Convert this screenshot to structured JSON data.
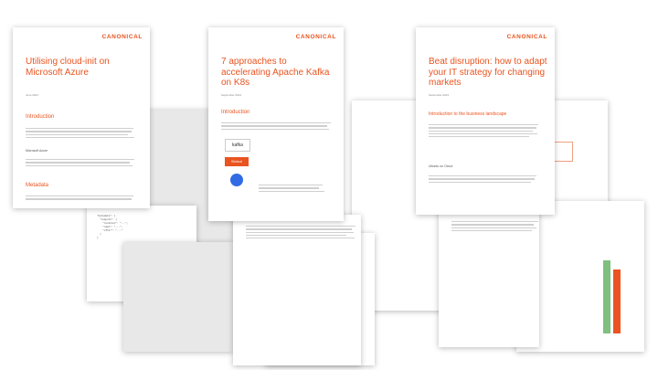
{
  "brand": {
    "logo": "CANONICAL",
    "accent": "#e95420"
  },
  "docs": [
    {
      "title": "Utilising cloud-init on Microsoft Azure",
      "date": "June 2021",
      "sections": [
        "Introduction",
        "Metadata"
      ],
      "subsection": "Microsoft Azure"
    },
    {
      "title": "7 approaches to accelerating Apache Kafka on K8s",
      "date": "September 2021",
      "section": "Introduction",
      "badges": [
        "kafka",
        "Strimzi"
      ]
    },
    {
      "title": "Beat disruption: how to adapt your IT strategy for changing markets",
      "date": "September 2021",
      "section": "Introduction to the business landscape",
      "subsection": "Ubuntu on Cloud"
    }
  ]
}
